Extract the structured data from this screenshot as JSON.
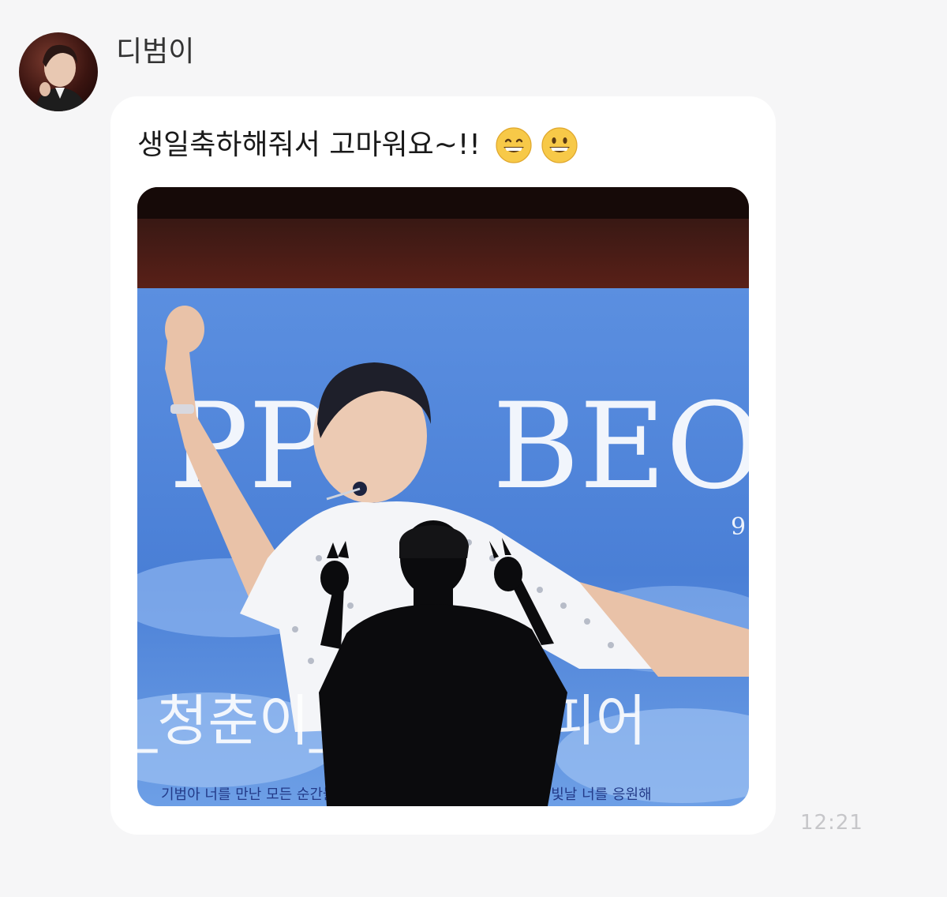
{
  "chat": {
    "sender_name": "디범이",
    "avatar_icon": "profile-photo",
    "message_text": "생일축하해줘서 고마워요~!!",
    "emojis": [
      "grinning-face-icon",
      "grinning-face-icon"
    ],
    "timestamp": "12:21"
  },
  "photo": {
    "banner_text_left": "PPY",
    "banner_text_right": "BEOMD",
    "banner_small_text": "9",
    "banner_handwriting": "_청춘이_꽃_활짝_피어",
    "banner_bottom_left": "기범아 너를 만난 모든 순간들이 내겐",
    "banner_bottom_right": "앞으로도 더 빛날 너를 응원해"
  },
  "colors": {
    "background": "#f6f6f7",
    "bubble": "#ffffff",
    "timestamp": "#c6c6c9",
    "sky": "#4a7fd6"
  }
}
